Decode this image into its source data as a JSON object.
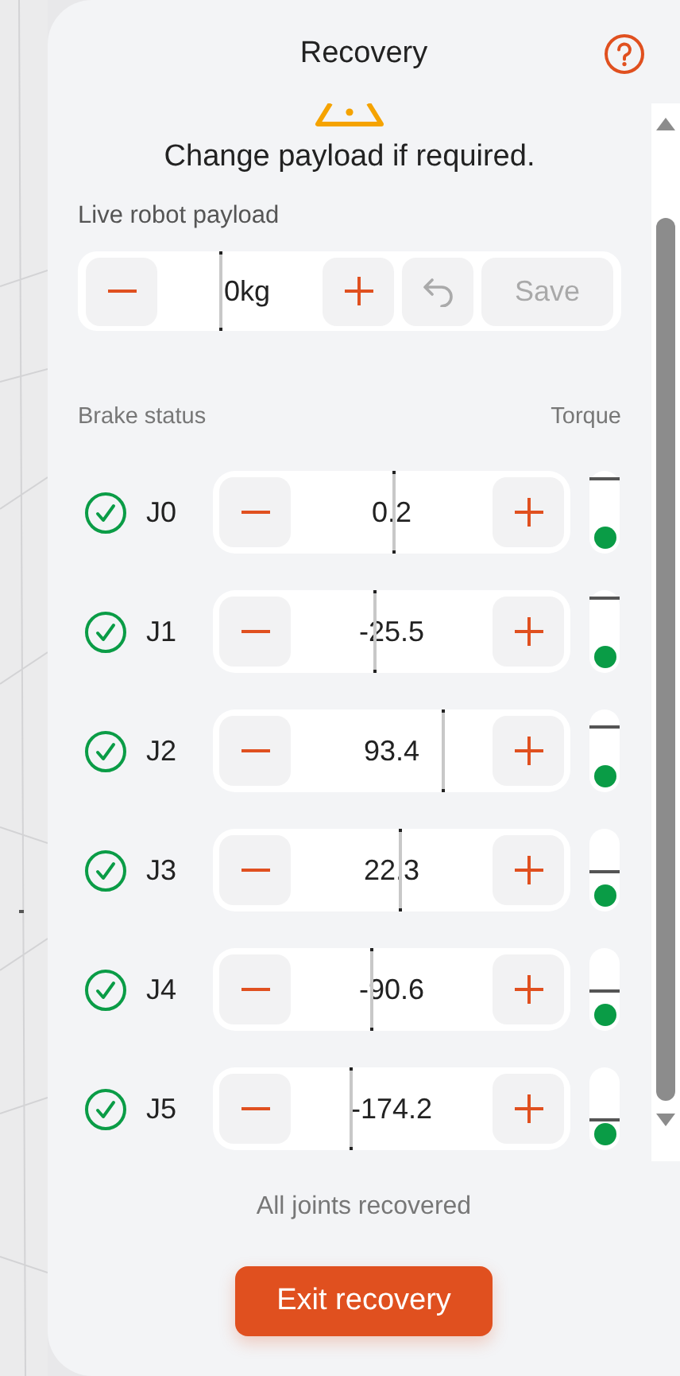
{
  "title": "Recovery",
  "message": "Change payload if required.",
  "payload": {
    "label": "Live robot payload",
    "value": "0kg",
    "level": 0.26,
    "save": "Save",
    "save_disabled": true
  },
  "columns": {
    "left": "Brake status",
    "right": "Torque"
  },
  "joints": [
    {
      "name": "J0",
      "value": "0.2",
      "recovered": true,
      "level": 0.5,
      "torque": {
        "level": 0.93
      }
    },
    {
      "name": "J1",
      "value": "-25.5",
      "recovered": true,
      "level": 0.45,
      "torque": {
        "level": 0.93
      }
    },
    {
      "name": "J2",
      "value": "93.4",
      "recovered": true,
      "level": 0.64,
      "torque": {
        "level": 0.8
      }
    },
    {
      "name": "J3",
      "value": "22.3",
      "recovered": true,
      "level": 0.52,
      "torque": {
        "level": 0.5
      }
    },
    {
      "name": "J4",
      "value": "-90.6",
      "recovered": true,
      "level": 0.44,
      "torque": {
        "level": 0.5
      }
    },
    {
      "name": "J5",
      "value": "-174.2",
      "recovered": true,
      "level": 0.38,
      "torque": {
        "level": 0.38
      }
    }
  ],
  "status": "All joints recovered",
  "exit_button": "Exit recovery"
}
